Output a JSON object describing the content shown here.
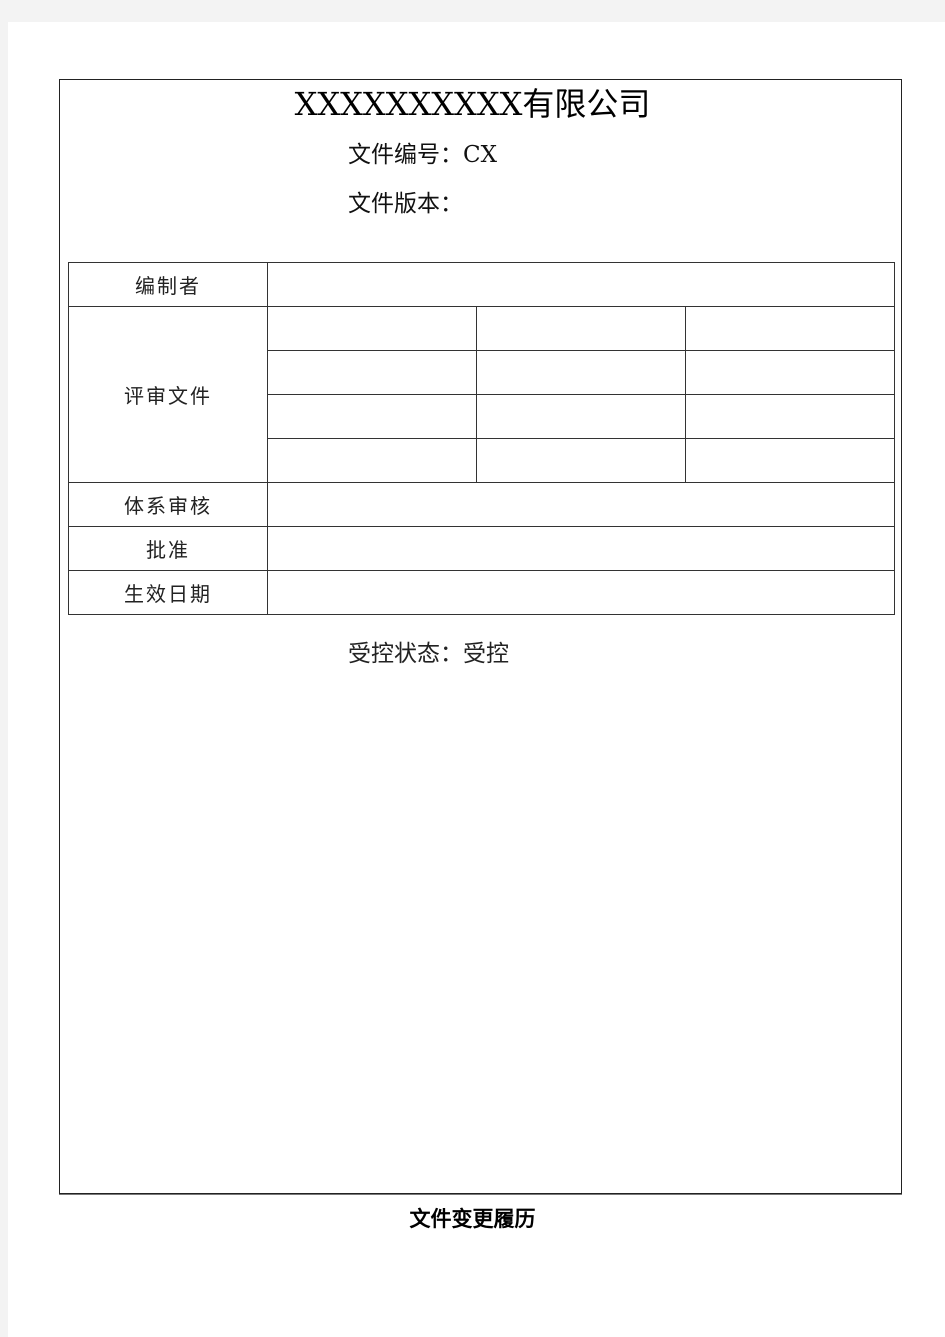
{
  "document": {
    "company_title": "XXXXXXXXXX有限公司",
    "doc_number": {
      "label": "文件编号：",
      "value": "CX"
    },
    "doc_version": {
      "label": "文件版本：",
      "value": ""
    }
  },
  "form": {
    "rows": [
      {
        "label": "编制者",
        "value": ""
      },
      {
        "label": "评审文件",
        "grid": [
          [
            "",
            "",
            ""
          ],
          [
            "",
            "",
            ""
          ],
          [
            "",
            "",
            ""
          ],
          [
            "",
            "",
            ""
          ]
        ]
      },
      {
        "label": "体系审核",
        "value": ""
      },
      {
        "label": "批准",
        "value": ""
      },
      {
        "label": "生效日期",
        "value": ""
      }
    ]
  },
  "control_status": {
    "label": "受控状态：",
    "value": "受控"
  },
  "footer": {
    "section_title": "文件变更履历"
  }
}
